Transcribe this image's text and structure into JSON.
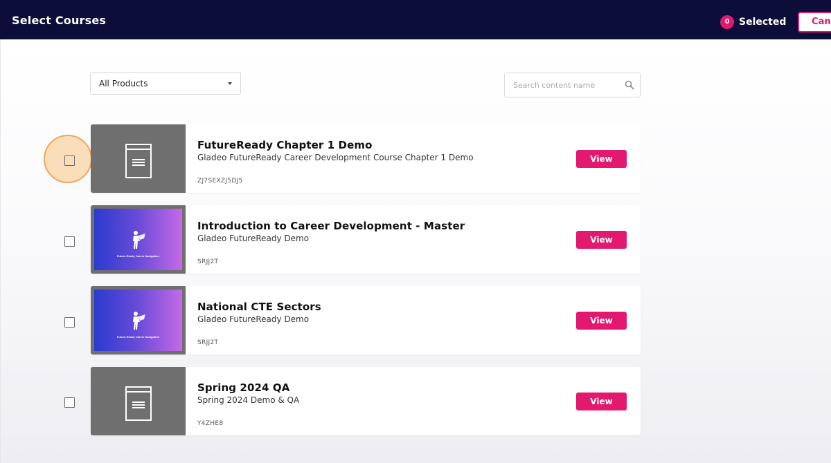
{
  "header": {
    "title": "Select Courses",
    "selected_count": "0",
    "selected_label": "Selected",
    "cancel_label": "Cancel"
  },
  "filters": {
    "product_dropdown": "All Products",
    "search_placeholder": "Search content name"
  },
  "courses": [
    {
      "title": "FutureReady Chapter 1 Demo",
      "subtitle": "Gladeo FutureReady Career Development Course Chapter 1 Demo",
      "code": "ZJ7SEXZJ5DJ5",
      "thumbnail": "document-icon",
      "checked": false,
      "view_label": "View"
    },
    {
      "title": "Introduction to Career Development - Master",
      "subtitle": "Gladeo FutureReady Demo",
      "code": "SRJJ2T",
      "thumbnail": "future-ready-banner",
      "thumbnail_caption": "Future-Ready Career Navigation",
      "checked": false,
      "view_label": "View"
    },
    {
      "title": "National CTE Sectors",
      "subtitle": "Gladeo FutureReady Demo",
      "code": "SRJJ2T",
      "thumbnail": "future-ready-banner",
      "thumbnail_caption": "Future-Ready Career Navigation",
      "checked": false,
      "view_label": "View"
    },
    {
      "title": "Spring 2024 QA",
      "subtitle": "Spring 2024 Demo & QA",
      "code": "Y4ZHE8",
      "thumbnail": "document-icon",
      "checked": false,
      "view_label": "View"
    }
  ],
  "colors": {
    "header_bg": "#0d0d3a",
    "accent": "#e3186f",
    "thumbnail_gray": "#6f6f6f",
    "highlight": "#f7c482"
  }
}
